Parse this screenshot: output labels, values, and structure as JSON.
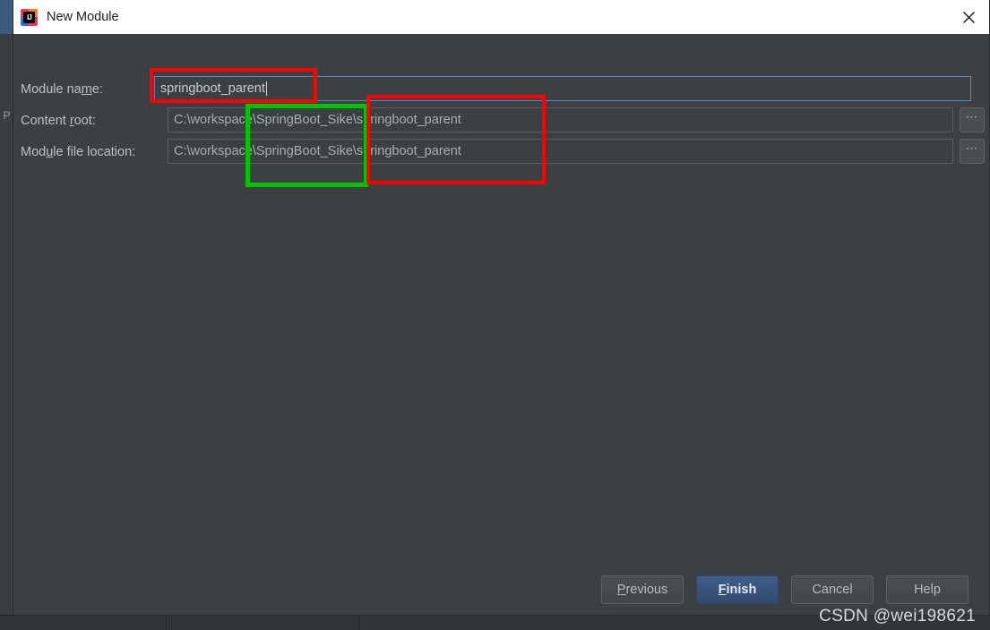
{
  "window": {
    "title": "New Module",
    "app_icon": "intellij-idea-icon",
    "icon_letters": "IJ",
    "close_label": "✕"
  },
  "form": {
    "rows": [
      {
        "label_before": "Module na",
        "label_mnemonic": "m",
        "label_after": "e:",
        "value": "springboot_parent",
        "focused": true,
        "has_browse": false
      },
      {
        "label_before": "Content ",
        "label_mnemonic": "r",
        "label_after": "oot:",
        "value": "C:\\workspace\\SpringBoot_Sike\\springboot_parent",
        "focused": false,
        "has_browse": true
      },
      {
        "label_before": "Mod",
        "label_mnemonic": "u",
        "label_after": "le file location:",
        "value": "C:\\workspace\\SpringBoot_Sike\\springboot_parent",
        "focused": false,
        "has_browse": true
      }
    ],
    "browse_label": "⋯"
  },
  "annotations": [
    {
      "name": "module-name-highlight",
      "color": "#fe0000",
      "shape": "rect"
    },
    {
      "name": "path-folder-highlight",
      "color": "#00c400",
      "shape": "rect"
    },
    {
      "name": "path-module-highlight",
      "color": "#fe0000",
      "shape": "rect"
    }
  ],
  "footer": {
    "buttons": [
      {
        "name": "previous",
        "before": "",
        "mnemonic": "P",
        "after": "revious",
        "primary": false
      },
      {
        "name": "finish",
        "before": "",
        "mnemonic": "F",
        "after": "inish",
        "primary": true
      },
      {
        "name": "cancel",
        "before": "Cancel",
        "mnemonic": "",
        "after": "",
        "primary": false
      },
      {
        "name": "help",
        "before": "Help",
        "mnemonic": "",
        "after": "",
        "primary": false
      }
    ]
  },
  "backdrop": {
    "side_letter": "P"
  },
  "watermark": {
    "text": "CSDN @wei198621"
  },
  "colors": {
    "dialog_bg": "#3c4043",
    "titlebar_bg": "#ffffff",
    "accent_blue": "#5a87c4",
    "primary_button": "#36527a",
    "annotation_red": "#fe0000",
    "annotation_green": "#00c400"
  }
}
